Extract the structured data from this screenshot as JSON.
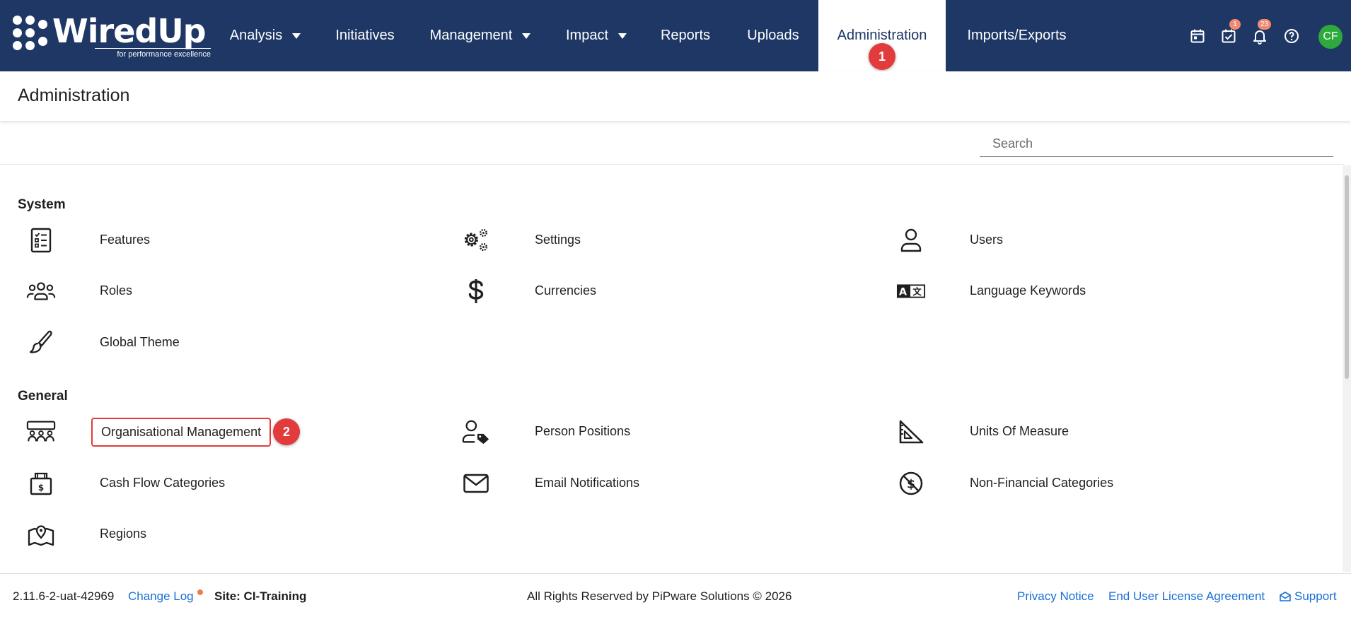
{
  "app": {
    "logo_text": "WiredUp",
    "logo_tagline": "for performance excellence"
  },
  "nav": {
    "items": [
      {
        "label": "Analysis",
        "dropdown": true
      },
      {
        "label": "Initiatives",
        "dropdown": false
      },
      {
        "label": "Management",
        "dropdown": true
      },
      {
        "label": "Impact",
        "dropdown": true
      },
      {
        "label": "Reports",
        "dropdown": false
      },
      {
        "label": "Uploads",
        "dropdown": false
      },
      {
        "label": "Administration",
        "dropdown": false,
        "active": true
      },
      {
        "label": "Imports/Exports",
        "dropdown": false
      }
    ],
    "active_marker": "1"
  },
  "toolbar": {
    "icons": [
      "calendar-icon",
      "task-check-icon",
      "bell-icon",
      "help-icon"
    ],
    "tasks_badge": "1",
    "notifications_badge": "23",
    "avatar_initials": "CF"
  },
  "page": {
    "title": "Administration"
  },
  "search": {
    "placeholder": "Search",
    "value": ""
  },
  "sections": {
    "system": {
      "title": "System",
      "items": [
        {
          "label": "Features",
          "icon": "checklist-icon"
        },
        {
          "label": "Settings",
          "icon": "gears-icon"
        },
        {
          "label": "Users",
          "icon": "user-icon"
        },
        {
          "label": "Roles",
          "icon": "group-icon"
        },
        {
          "label": "Currencies",
          "icon": "dollar-icon"
        },
        {
          "label": "Language Keywords",
          "icon": "translate-icon"
        },
        {
          "label": "Global Theme",
          "icon": "brush-icon"
        }
      ]
    },
    "general": {
      "title": "General",
      "items": [
        {
          "label": "Organisational Management",
          "icon": "org-chart-icon",
          "highlighted": true
        },
        {
          "label": "Person Positions",
          "icon": "person-tag-icon"
        },
        {
          "label": "Units Of Measure",
          "icon": "set-square-icon"
        },
        {
          "label": "Cash Flow Categories",
          "icon": "cash-box-icon"
        },
        {
          "label": "Email Notifications",
          "icon": "envelope-icon"
        },
        {
          "label": "Non-Financial Categories",
          "icon": "no-dollar-icon"
        },
        {
          "label": "Regions",
          "icon": "map-pin-icon"
        }
      ],
      "highlight_marker": "2"
    }
  },
  "footer": {
    "version": "2.11.6-2-uat-42969",
    "change_log": "Change Log",
    "site": "Site: CI-Training",
    "copyright": "All Rights Reserved by PiPware Solutions © 2026",
    "privacy": "Privacy Notice",
    "eula": "End User License Agreement",
    "support": "Support"
  },
  "colors": {
    "nav_bg": "#1e3765",
    "marker_red": "#e23b3b",
    "badge_orange": "#f08a70",
    "avatar_green": "#2eaa3c",
    "link_blue": "#1a6fd6"
  }
}
